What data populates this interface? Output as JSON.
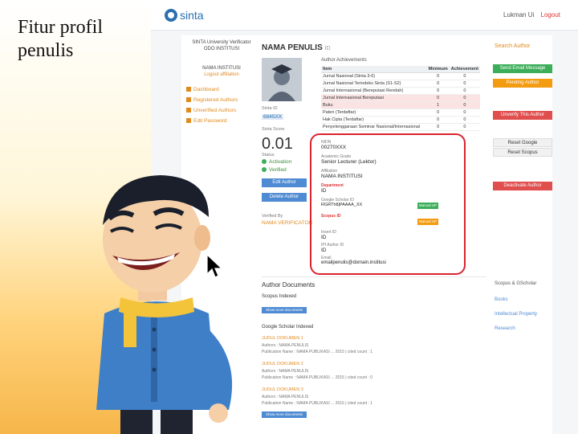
{
  "slide": {
    "title": "Fitur profil penulis"
  },
  "navbar": {
    "logo_text": "sinta",
    "user_text": "Lukman Ui",
    "user_extra": "Logout"
  },
  "institution": {
    "line1": "SINTA University Verificator",
    "line2": "ODO INSTITUSI",
    "name": "NAMA INSTITUSI",
    "link": "Logout affiliation"
  },
  "sidebar_links": [
    "Dashboard",
    "Registered Authors",
    "Unverified Authors",
    "Edit Password"
  ],
  "author": {
    "name": "NAMA PENULIS",
    "id_suffix": "ID",
    "sinta_id_label": "Sinta ID",
    "sinta_id": "6845XX",
    "score_label": "Sinta Score",
    "score": "0.01",
    "status_label": "Status",
    "status_activation": "Activation",
    "status_verified": "Verified",
    "edit_button": "Edit Author",
    "delete_button": "Delete Author",
    "verified_by_label": "Verified By",
    "verified_by": "NAMA VERIFICATOR"
  },
  "achievements": {
    "title": "Author Achievements",
    "columns": [
      "Item",
      "Minimum",
      "Achievement"
    ],
    "rows": [
      {
        "item": "Jurnal Nasional (Sinta 3-6)",
        "min": "0",
        "ach": "0"
      },
      {
        "item": "Jurnal Nasional Terindeks Sinta (S1-S2)",
        "min": "0",
        "ach": "0"
      },
      {
        "item": "Jurnal Internasional (Bereputasi Rendah)",
        "min": "0",
        "ach": "0"
      },
      {
        "item": "Jurnal Internasional Bereputasi",
        "min": "0",
        "ach": "0"
      },
      {
        "item": "Buku",
        "min": "1",
        "ach": "0"
      },
      {
        "item": "Paten (Terdaftar)",
        "min": "0",
        "ach": "0"
      },
      {
        "item": "Hak Cipta (Terdaftar)",
        "min": "0",
        "ach": "0"
      },
      {
        "item": "Penyelenggaraan Seminar Nasional/Internasional",
        "min": "0",
        "ach": "0"
      }
    ],
    "highlight_rows": [
      3,
      4
    ]
  },
  "fields": {
    "nidn_label": "NIDN",
    "nidn": "00270XXX",
    "academic_grade_label": "Academic Grade",
    "academic_grade": "Senior Lecturer (Lektor)",
    "affiliation_label": "Affiliation",
    "affiliation": "NAMA INSTITUSI",
    "department_label": "Department",
    "department": "ID",
    "scholar_label": "Google Scholar ID",
    "scholar": "RGRTh8jPAAAA_XX",
    "scholar_btn": "Manual UP",
    "scopus_label": "Scopus ID",
    "scopus_btn": "Manual UP",
    "inset_label": "Insert ID",
    "inset_val": "ID",
    "ipi_label": "IPI Author ID",
    "ipi_val": "ID",
    "email_label": "Email",
    "email": "emailpenulis@domain.institusi"
  },
  "actions": {
    "search": "Search Author",
    "send_email": "Send Email Message",
    "pending": "Pending Author",
    "unverify": "Unverify This Author",
    "reset_google": "Reset Google",
    "reset_scopus": "Reset Scopus",
    "deactivate": "Deactivate Author"
  },
  "documents": {
    "title": "Author Documents",
    "scopus_indexed": "Scopus Indexed",
    "show_more": "Show more documents",
    "scholar_indexed": "Google Scholar Indexed",
    "items": [
      {
        "title": "JUDUL DOKUMEN 1",
        "authors": "Authors : NAMA PENULIS",
        "pub": "Publication Name : NAMA PUBLIKASI ... 2015 | cited count : 1"
      },
      {
        "title": "JUDUL DOKUMEN 2",
        "authors": "Authors : NAMA PENULIS",
        "pub": "Publication Name : NAMA PUBLIKASI ... 2015 | cited count : 0"
      },
      {
        "title": "JUDUL DOKUMEN 3",
        "authors": "Authors : NAMA PENULIS",
        "pub": "Publication Name : NAMA PUBLIKASI ... 2016 | cited count : 1"
      }
    ],
    "show_more_2": "Show more documents"
  },
  "side_docs": {
    "header": "Scopus & GScholar",
    "links": [
      "Books",
      "Intellectual Property",
      "Research"
    ]
  }
}
